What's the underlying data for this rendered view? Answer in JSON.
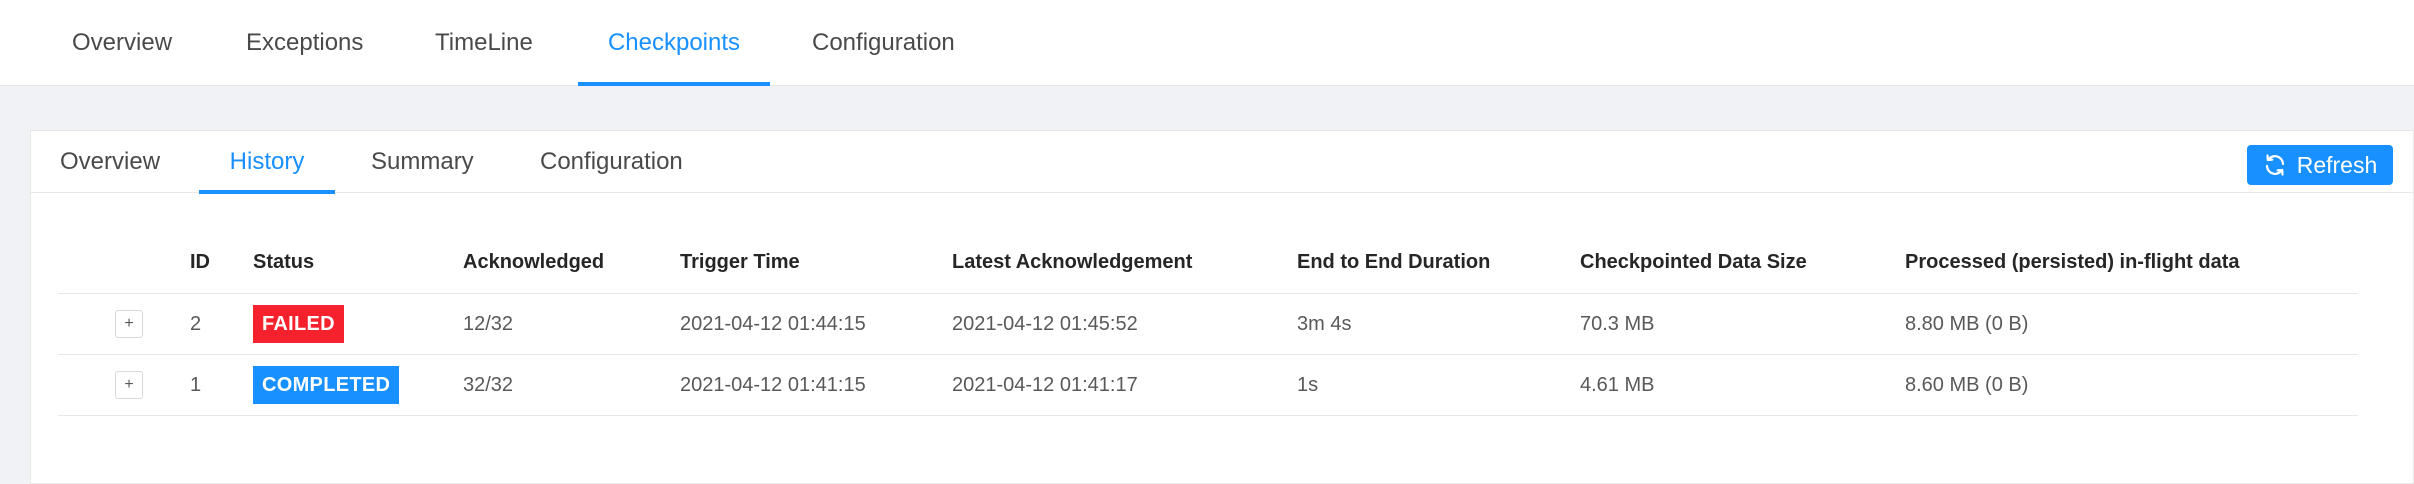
{
  "top_tabs": [
    {
      "label": "Overview"
    },
    {
      "label": "Exceptions"
    },
    {
      "label": "TimeLine"
    },
    {
      "label": "Checkpoints"
    },
    {
      "label": "Configuration"
    }
  ],
  "top_tabs_active": "Checkpoints",
  "inner_tabs": [
    {
      "label": "Overview"
    },
    {
      "label": "History"
    },
    {
      "label": "Summary"
    },
    {
      "label": "Configuration"
    }
  ],
  "inner_tabs_active": "History",
  "refresh_label": "Refresh",
  "table": {
    "headers": [
      "ID",
      "Status",
      "Acknowledged",
      "Trigger Time",
      "Latest Acknowledgement",
      "End to End Duration",
      "Checkpointed Data Size",
      "Processed (persisted) in-flight data"
    ],
    "rows": [
      {
        "expand": "+",
        "id": "2",
        "status": "FAILED",
        "acknowledged": "12/32",
        "trigger_time": "2021-04-12 01:44:15",
        "latest_ack": "2021-04-12 01:45:52",
        "duration": "3m 4s",
        "data_size": "70.3 MB",
        "inflight": "8.80 MB (0 B)"
      },
      {
        "expand": "+",
        "id": "1",
        "status": "COMPLETED",
        "acknowledged": "32/32",
        "trigger_time": "2021-04-12 01:41:15",
        "latest_ack": "2021-04-12 01:41:17",
        "duration": "1s",
        "data_size": "4.61 MB",
        "inflight": "8.60 MB (0 B)"
      }
    ]
  },
  "colors": {
    "accent": "#1890ff",
    "failed": "#f5222d",
    "completed": "#1890ff"
  }
}
